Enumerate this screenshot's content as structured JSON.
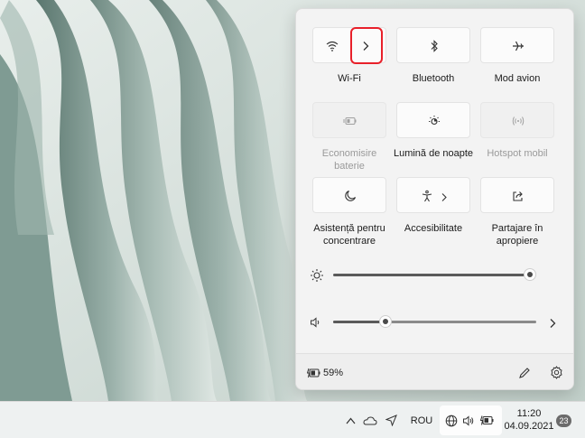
{
  "tiles": [
    {
      "label": "Wi-Fi",
      "icon": "wifi-icon",
      "enabled": true,
      "has_chevron": true
    },
    {
      "label": "Bluetooth",
      "icon": "bluetooth-icon",
      "enabled": true
    },
    {
      "label": "Mod avion",
      "icon": "airplane-icon",
      "enabled": true
    },
    {
      "label": "Economisire baterie",
      "icon": "battery-saver-icon",
      "enabled": false
    },
    {
      "label": "Lumină de noapte",
      "icon": "night-light-icon",
      "enabled": true
    },
    {
      "label": "Hotspot mobil",
      "icon": "hotspot-icon",
      "enabled": false
    },
    {
      "label": "Asistență pentru concentrare",
      "icon": "moon-icon",
      "enabled": true
    },
    {
      "label": "Accesibilitate",
      "icon": "accessibility-icon",
      "enabled": true,
      "has_chevron": true
    },
    {
      "label": "Partajare în apropiere",
      "icon": "share-icon",
      "enabled": true
    }
  ],
  "sliders": {
    "brightness": {
      "value": 100,
      "icon": "brightness-icon"
    },
    "volume": {
      "value": 25,
      "icon": "speaker-icon"
    }
  },
  "footer": {
    "battery_text": "59%",
    "battery_icon": "battery-charging-icon",
    "edit_icon": "pencil-icon",
    "settings_icon": "gear-icon"
  },
  "taskbar": {
    "language": "ROU",
    "time": "11:20",
    "date": "04.09.2021",
    "notifications": "23"
  },
  "highlight_color": "#e8202a"
}
